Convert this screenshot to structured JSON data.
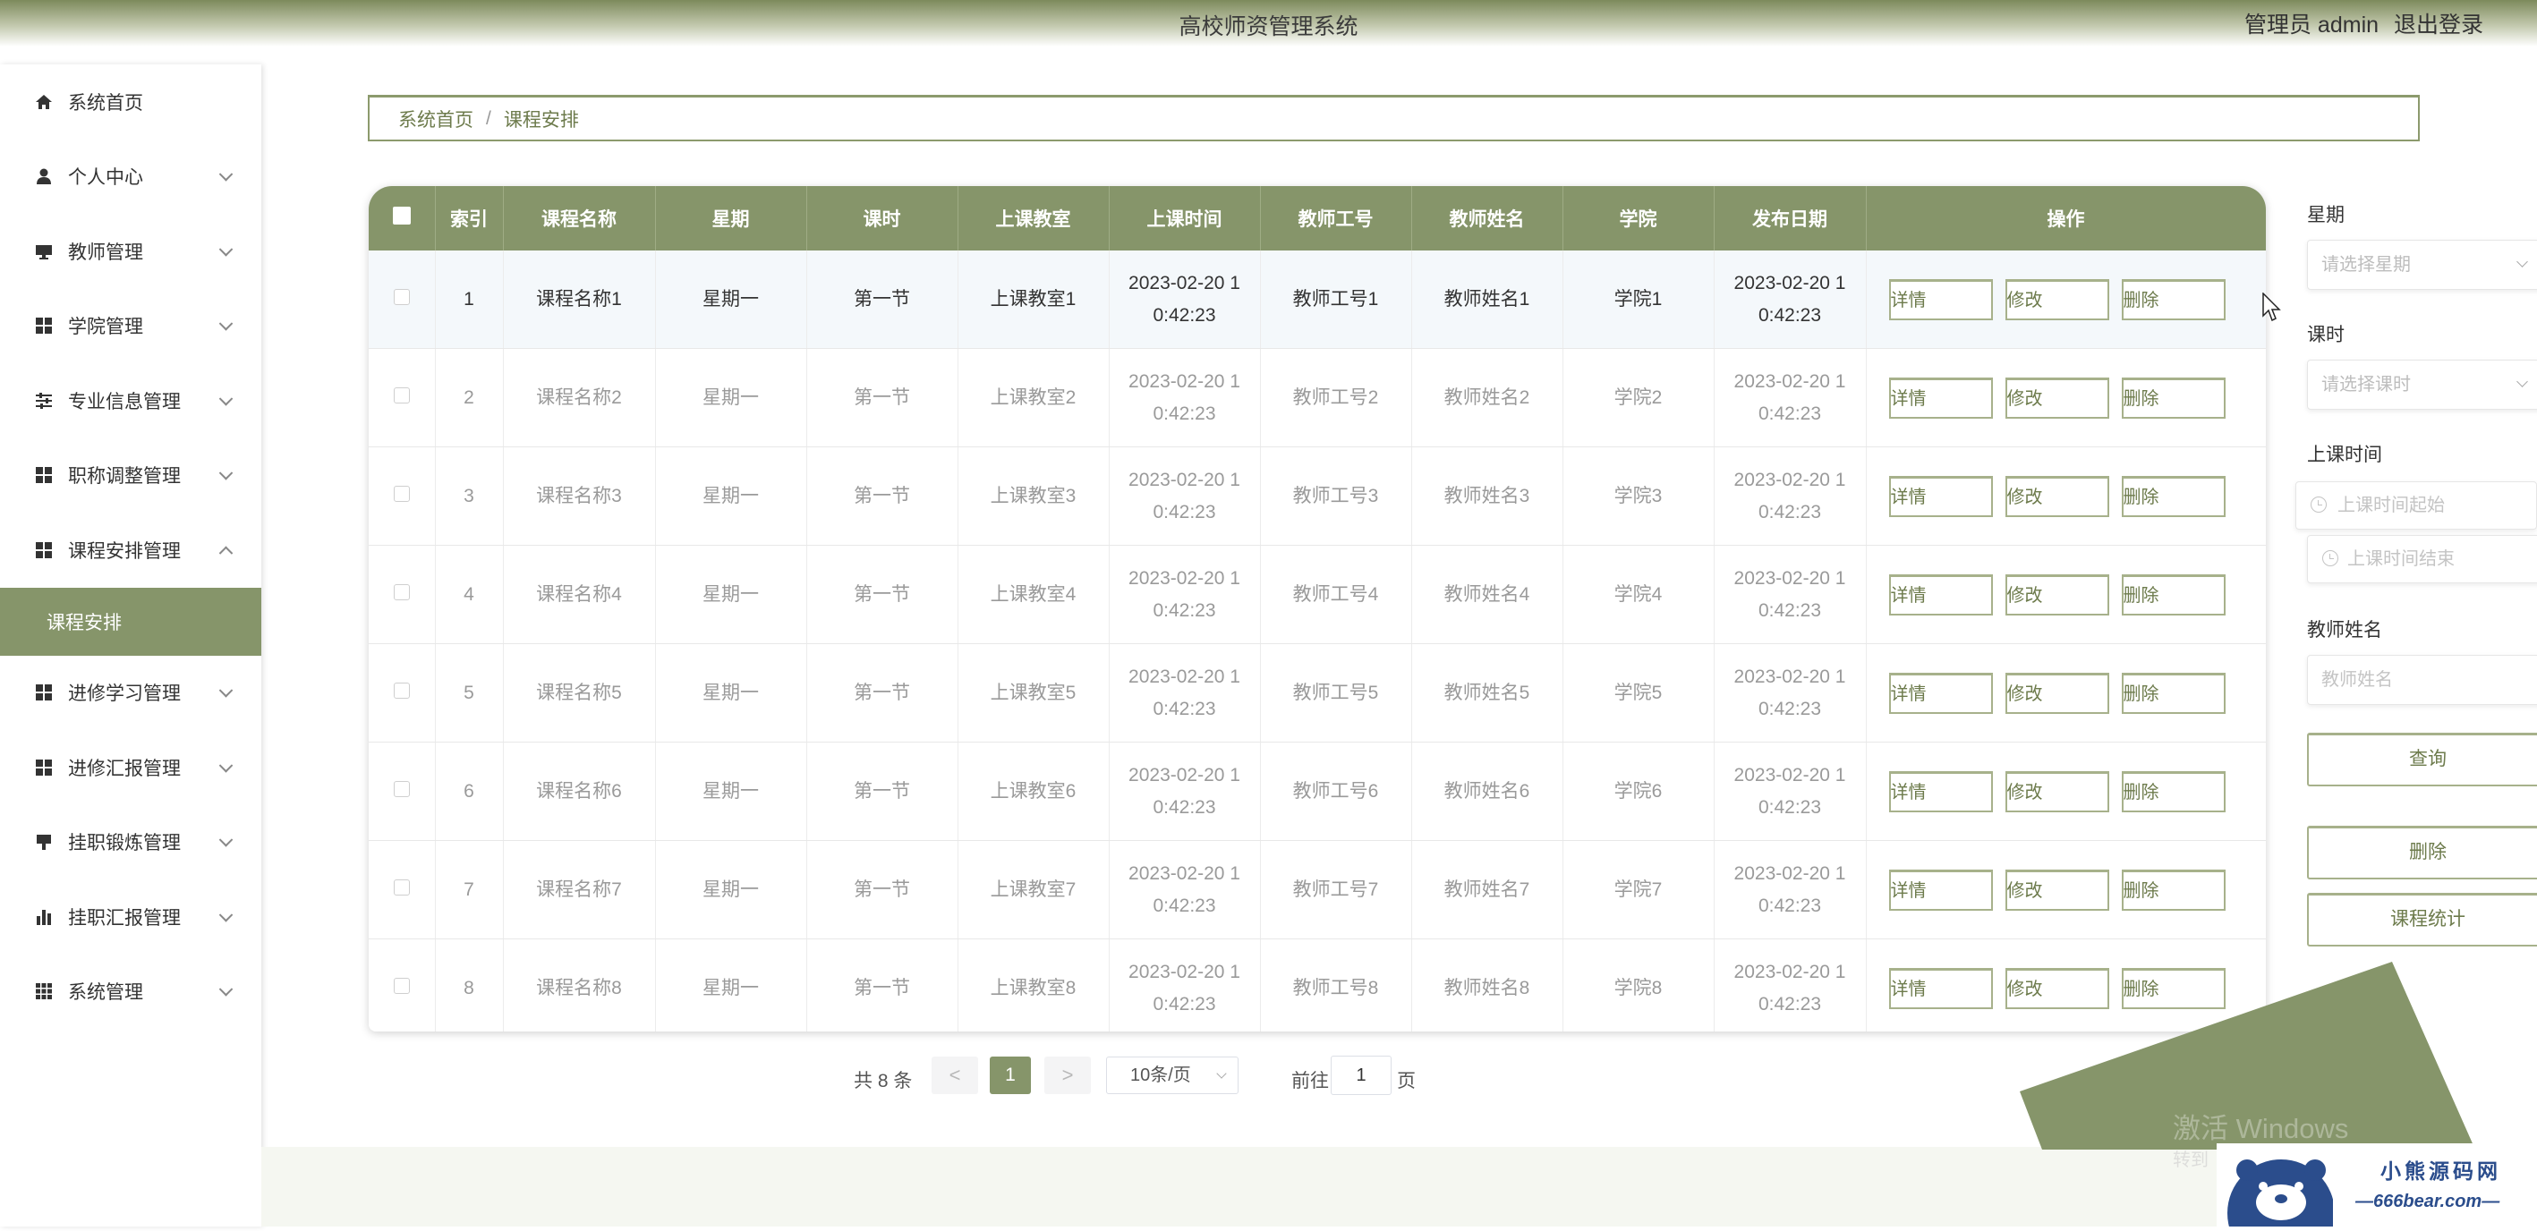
{
  "app": {
    "title": "高校师资管理系统",
    "user_label": "管理员 admin",
    "logout_label": "退出登录"
  },
  "sidebar": {
    "items": [
      {
        "label": "系统首页",
        "icon": "home-icon"
      },
      {
        "label": "个人中心",
        "icon": "user-icon"
      },
      {
        "label": "教师管理",
        "icon": "monitor-icon"
      },
      {
        "label": "学院管理",
        "icon": "grid-icon"
      },
      {
        "label": "专业信息管理",
        "icon": "sliders-icon"
      },
      {
        "label": "职称调整管理",
        "icon": "grid-icon"
      },
      {
        "label": "课程安排管理",
        "icon": "grid-icon"
      },
      {
        "label": "进修学习管理",
        "icon": "grid-icon"
      },
      {
        "label": "进修汇报管理",
        "icon": "grid-icon"
      },
      {
        "label": "挂职锻炼管理",
        "icon": "pin-icon"
      },
      {
        "label": "挂职汇报管理",
        "icon": "bar-chart-icon"
      },
      {
        "label": "系统管理",
        "icon": "apps-icon"
      }
    ],
    "active_submenu": "课程安排"
  },
  "breadcrumb": {
    "home": "系统首页",
    "separator": "/",
    "current": "课程安排"
  },
  "table": {
    "headers": [
      "索引",
      "课程名称",
      "星期",
      "课时",
      "上课教室",
      "上课时间",
      "教师工号",
      "教师姓名",
      "学院",
      "发布日期",
      "操作"
    ],
    "rows": [
      {
        "index": "1",
        "course": "课程名称1",
        "weekday": "星期一",
        "period": "第一节",
        "room": "上课教室1",
        "time1": "2023-02-20 1",
        "time2": "0:42:23",
        "teacher_no": "教师工号1",
        "teacher_name": "教师姓名1",
        "college": "学院1",
        "date1": "2023-02-20 1",
        "date2": "0:42:23"
      },
      {
        "index": "2",
        "course": "课程名称2",
        "weekday": "星期一",
        "period": "第一节",
        "room": "上课教室2",
        "time1": "2023-02-20 1",
        "time2": "0:42:23",
        "teacher_no": "教师工号2",
        "teacher_name": "教师姓名2",
        "college": "学院2",
        "date1": "2023-02-20 1",
        "date2": "0:42:23"
      },
      {
        "index": "3",
        "course": "课程名称3",
        "weekday": "星期一",
        "period": "第一节",
        "room": "上课教室3",
        "time1": "2023-02-20 1",
        "time2": "0:42:23",
        "teacher_no": "教师工号3",
        "teacher_name": "教师姓名3",
        "college": "学院3",
        "date1": "2023-02-20 1",
        "date2": "0:42:23"
      },
      {
        "index": "4",
        "course": "课程名称4",
        "weekday": "星期一",
        "period": "第一节",
        "room": "上课教室4",
        "time1": "2023-02-20 1",
        "time2": "0:42:23",
        "teacher_no": "教师工号4",
        "teacher_name": "教师姓名4",
        "college": "学院4",
        "date1": "2023-02-20 1",
        "date2": "0:42:23"
      },
      {
        "index": "5",
        "course": "课程名称5",
        "weekday": "星期一",
        "period": "第一节",
        "room": "上课教室5",
        "time1": "2023-02-20 1",
        "time2": "0:42:23",
        "teacher_no": "教师工号5",
        "teacher_name": "教师姓名5",
        "college": "学院5",
        "date1": "2023-02-20 1",
        "date2": "0:42:23"
      },
      {
        "index": "6",
        "course": "课程名称6",
        "weekday": "星期一",
        "period": "第一节",
        "room": "上课教室6",
        "time1": "2023-02-20 1",
        "time2": "0:42:23",
        "teacher_no": "教师工号6",
        "teacher_name": "教师姓名6",
        "college": "学院6",
        "date1": "2023-02-20 1",
        "date2": "0:42:23"
      },
      {
        "index": "7",
        "course": "课程名称7",
        "weekday": "星期一",
        "period": "第一节",
        "room": "上课教室7",
        "time1": "2023-02-20 1",
        "time2": "0:42:23",
        "teacher_no": "教师工号7",
        "teacher_name": "教师姓名7",
        "college": "学院7",
        "date1": "2023-02-20 1",
        "date2": "0:42:23"
      },
      {
        "index": "8",
        "course": "课程名称8",
        "weekday": "星期一",
        "period": "第一节",
        "room": "上课教室8",
        "time1": "2023-02-20 1",
        "time2": "0:42:23",
        "teacher_no": "教师工号8",
        "teacher_name": "教师姓名8",
        "college": "学院8",
        "date1": "2023-02-20 1",
        "date2": "0:42:23"
      }
    ],
    "actions": {
      "detail": "详情",
      "edit": "修改",
      "delete": "删除"
    }
  },
  "pagination": {
    "total": "共 8 条",
    "prev": "<",
    "next": ">",
    "current_page": "1",
    "page_size": "10条/页",
    "goto_prefix": "前往",
    "goto_value": "1",
    "goto_suffix": "页"
  },
  "filters": {
    "weekday_label": "星期",
    "weekday_placeholder": "请选择星期",
    "period_label": "课时",
    "period_placeholder": "请选择课时",
    "time_label": "上课时间",
    "time_start_placeholder": "上课时间起始",
    "time_end_placeholder": "上课时间结束",
    "teacher_label": "教师姓名",
    "teacher_placeholder": "教师姓名",
    "query_button": "查询",
    "delete_button": "删除",
    "stats_button": "课程统计"
  },
  "overlay": {
    "watermark": "激活 Windows",
    "watermark_sub": "转到",
    "badge_title": "小熊源码网",
    "badge_url": "—666bear.com—"
  },
  "colors": {
    "accent": "#86956a",
    "accent_dark": "#6d7b4c",
    "header_gradient_top": "#7d8a5c"
  }
}
